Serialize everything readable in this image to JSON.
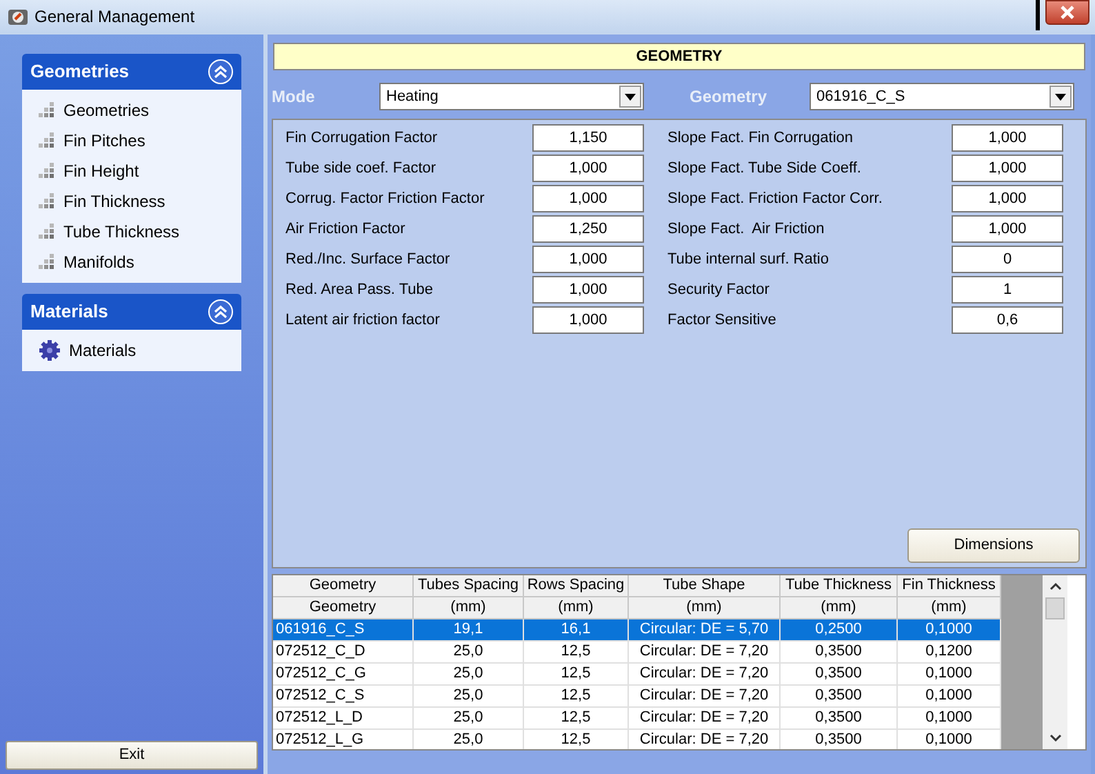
{
  "window": {
    "title": "General Management"
  },
  "sidebar": {
    "groups": [
      {
        "title": "Geometries",
        "expanded": true,
        "items": [
          {
            "label": "Geometries",
            "kind": "grid"
          },
          {
            "label": "Fin Pitches",
            "kind": "grid"
          },
          {
            "label": "Fin Height",
            "kind": "grid"
          },
          {
            "label": "Fin Thickness",
            "kind": "grid"
          },
          {
            "label": "Tube Thickness",
            "kind": "grid"
          },
          {
            "label": "Manifolds",
            "kind": "grid"
          }
        ]
      },
      {
        "title": "Materials",
        "expanded": true,
        "items": [
          {
            "label": "Materials",
            "kind": "gear"
          }
        ]
      }
    ],
    "exit_button": "Exit"
  },
  "geometry_panel": {
    "title": "GEOMETRY",
    "mode": {
      "label": "Mode",
      "value": "Heating"
    },
    "geometry": {
      "label": "Geometry",
      "value": "061916_C_S"
    },
    "left_params": [
      {
        "label": "Fin Corrugation Factor",
        "value": "1,150"
      },
      {
        "label": "Tube side coef. Factor",
        "value": "1,000"
      },
      {
        "label": "Corrug. Factor Friction Factor",
        "value": "1,000"
      },
      {
        "label": "Air Friction Factor",
        "value": "1,250"
      },
      {
        "label": "Red./Inc. Surface Factor",
        "value": "1,000"
      },
      {
        "label": "Red. Area Pass. Tube",
        "value": "1,000"
      },
      {
        "label": "Latent air friction factor",
        "value": "1,000"
      }
    ],
    "right_params": [
      {
        "label": "Slope Fact. Fin Corrugation",
        "value": "1,000"
      },
      {
        "label": "Slope Fact. Tube Side Coeff.",
        "value": "1,000"
      },
      {
        "label": "Slope Fact. Friction Factor Corr.",
        "value": "1,000"
      },
      {
        "label": "Slope Fact.  Air Friction",
        "value": "1,000"
      },
      {
        "label": "Tube internal surf. Ratio",
        "value": "0"
      },
      {
        "label": "Security Factor",
        "value": "1"
      },
      {
        "label": "Factor Sensitive",
        "value": "0,6"
      }
    ],
    "dimensions_button": "Dimensions"
  },
  "table": {
    "columns": [
      {
        "header": "Geometry",
        "unit": "Geometry"
      },
      {
        "header": "Tubes Spacing",
        "unit": "(mm)"
      },
      {
        "header": "Rows Spacing",
        "unit": "(mm)"
      },
      {
        "header": "Tube Shape",
        "unit": "(mm)"
      },
      {
        "header": "Tube Thickness",
        "unit": "(mm)"
      },
      {
        "header": "Fin Thickness",
        "unit": "(mm)"
      }
    ],
    "rows": [
      {
        "selected": true,
        "cells": [
          "061916_C_S",
          "19,1",
          "16,1",
          "Circular: DE = 5,70",
          "0,2500",
          "0,1000"
        ]
      },
      {
        "selected": false,
        "cells": [
          "072512_C_D",
          "25,0",
          "12,5",
          "Circular: DE = 7,20",
          "0,3500",
          "0,1200"
        ]
      },
      {
        "selected": false,
        "cells": [
          "072512_C_G",
          "25,0",
          "12,5",
          "Circular: DE = 7,20",
          "0,3500",
          "0,1000"
        ]
      },
      {
        "selected": false,
        "cells": [
          "072512_C_S",
          "25,0",
          "12,5",
          "Circular: DE = 7,20",
          "0,3500",
          "0,1000"
        ]
      },
      {
        "selected": false,
        "cells": [
          "072512_L_D",
          "25,0",
          "12,5",
          "Circular: DE = 7,20",
          "0,3500",
          "0,1000"
        ]
      },
      {
        "selected": false,
        "cells": [
          "072512_L_G",
          "25,0",
          "12,5",
          "Circular: DE = 7,20",
          "0,3500",
          "0,1000"
        ]
      }
    ]
  }
}
